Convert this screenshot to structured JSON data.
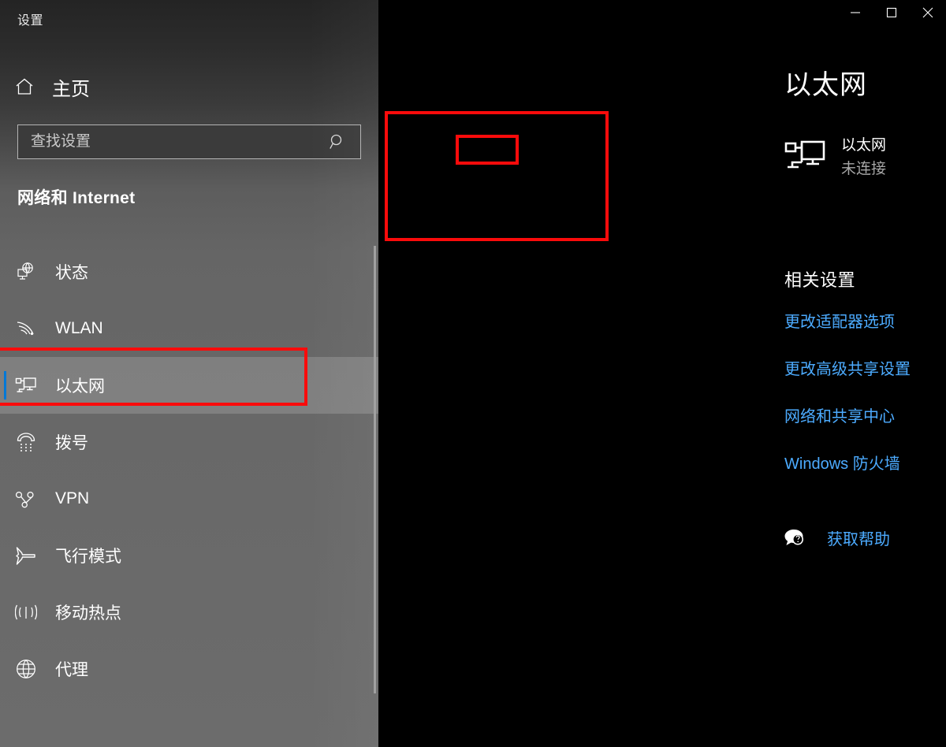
{
  "app": {
    "title": "设置"
  },
  "sidebar": {
    "home": {
      "label": "主页",
      "icon": "home-icon"
    },
    "search": {
      "placeholder": "查找设置",
      "value": "",
      "icon": "search-icon"
    },
    "category_title": "网络和 Internet",
    "items": [
      {
        "label": "状态",
        "icon": "globe-monitor-icon",
        "selected": false
      },
      {
        "label": "WLAN",
        "icon": "wifi-icon",
        "selected": false
      },
      {
        "label": "以太网",
        "icon": "ethernet-icon",
        "selected": true
      },
      {
        "label": "拨号",
        "icon": "dialup-phone-icon",
        "selected": false
      },
      {
        "label": "VPN",
        "icon": "vpn-key-icon",
        "selected": false
      },
      {
        "label": "飞行模式",
        "icon": "airplane-icon",
        "selected": false
      },
      {
        "label": "移动热点",
        "icon": "hotspot-icon",
        "selected": false
      },
      {
        "label": "代理",
        "icon": "globe-icon",
        "selected": false
      }
    ]
  },
  "titlebar": {
    "minimize_label": "最小化",
    "maximize_label": "最大化",
    "close_label": "关闭"
  },
  "main": {
    "page_title": "以太网",
    "adapter": {
      "name": "以太网",
      "status": "未连接",
      "icon": "ethernet-icon"
    },
    "related": {
      "heading": "相关设置",
      "links": [
        "更改适配器选项",
        "更改高级共享设置",
        "网络和共享中心",
        "Windows 防火墙"
      ]
    },
    "help": {
      "label": "获取帮助",
      "icon": "help-bubble-icon"
    }
  },
  "colors": {
    "accent_blue": "#0078d7",
    "link_blue": "#4cabff",
    "annotation_red": "#fb0b0b",
    "panel_black": "#000000",
    "status_gray": "#a6a6a6"
  },
  "annotations": [
    {
      "name": "sidebar-ethernet-highlight",
      "color": "#fb0b0b"
    },
    {
      "name": "ethernet-card-highlight",
      "color": "#fb0b0b"
    },
    {
      "name": "ethernet-name-highlight",
      "color": "#fb0b0b"
    }
  ]
}
